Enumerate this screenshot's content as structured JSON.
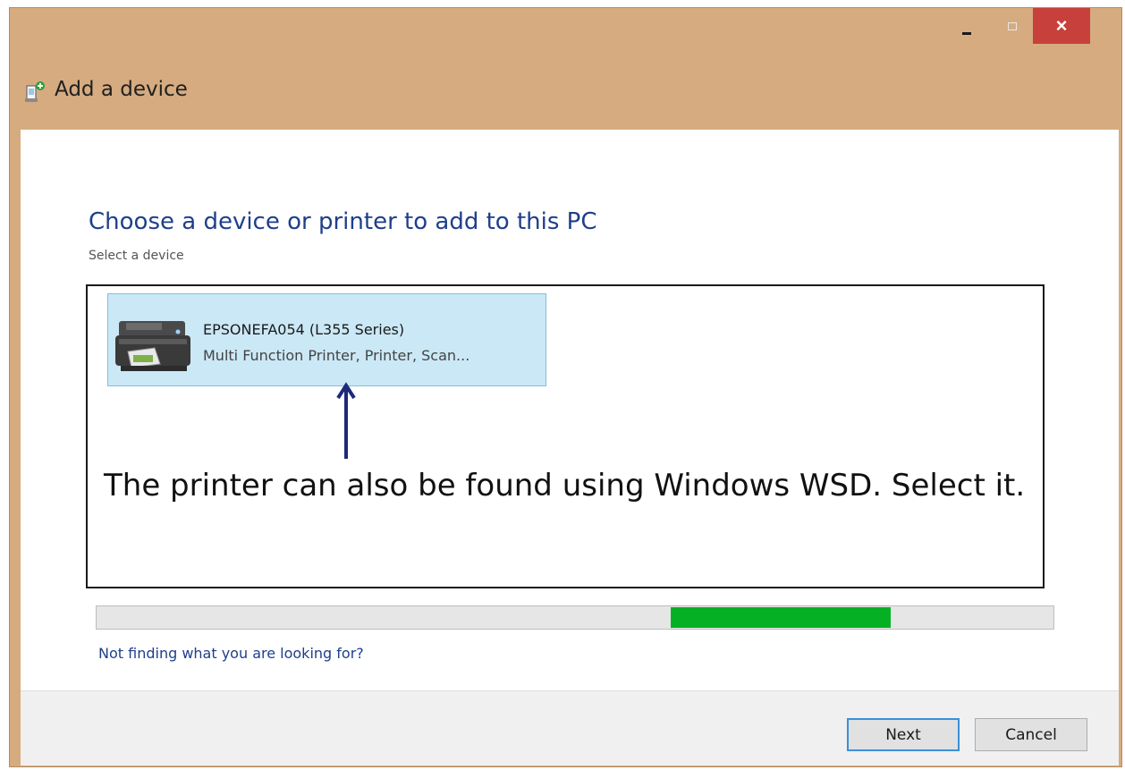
{
  "window": {
    "title": "Add a device",
    "controls": {
      "minimize": "minimize",
      "maximize": "maximize",
      "close": "×"
    }
  },
  "main": {
    "heading": "Choose a device or printer to add to this PC",
    "subheading": "Select a device",
    "devices": [
      {
        "name": "EPSONEFA054 (L355 Series)",
        "description": "Multi Function Printer, Printer, Scan...",
        "icon": "printer-icon",
        "selected": true
      }
    ],
    "annotation": "The printer can also be found using Windows WSD.  Select it.",
    "progress": {
      "value_start": 0.6,
      "value_end": 0.83,
      "color": "#06b025"
    },
    "help_link": "Not finding what you are looking for?"
  },
  "footer": {
    "next_label": "Next",
    "cancel_label": "Cancel"
  },
  "colors": {
    "frame": "#d6ab80",
    "heading": "#1f3f8a",
    "selection": "#cbe8f6",
    "close": "#c7403b"
  }
}
